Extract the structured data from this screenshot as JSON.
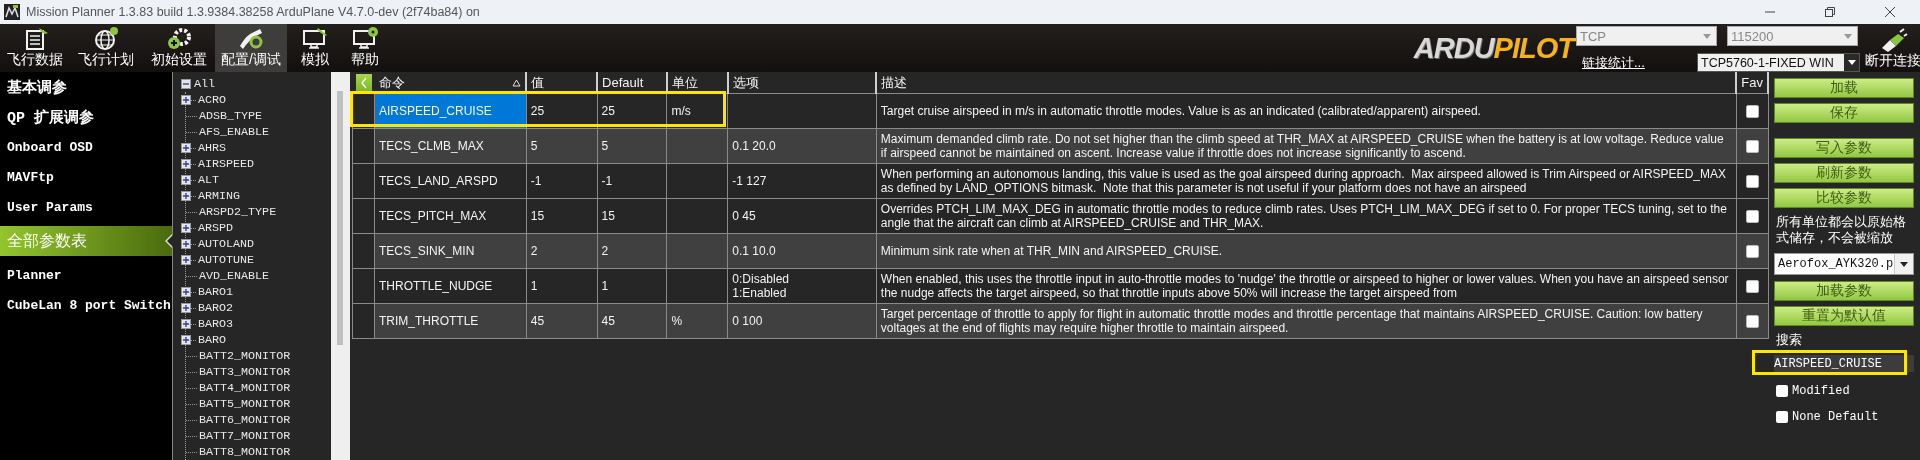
{
  "window": {
    "title": "Mission Planner 1.3.83 build 1.3.9384.38258 ArduPlane V4.7.0-dev (2f74ba84) on"
  },
  "toolbar": {
    "items": [
      {
        "label": "飞行数据",
        "kind": "data",
        "selected": false
      },
      {
        "label": "飞行计划",
        "kind": "plan",
        "selected": false
      },
      {
        "label": "初始设置",
        "kind": "setup",
        "selected": false
      },
      {
        "label": "配置/调试",
        "kind": "config",
        "selected": true
      },
      {
        "label": "模拟",
        "kind": "sim",
        "selected": false
      },
      {
        "label": "帮助",
        "kind": "help",
        "selected": false
      }
    ]
  },
  "logo": {
    "part_1": "ARDU",
    "part_2": "PILOT"
  },
  "connection": {
    "port": "TCP",
    "baud": "115200",
    "stats_link": "链接统计...",
    "profile": "TCP5760-1-FIXED WIN",
    "disconnect": "断开连接"
  },
  "sidebar": {
    "items": [
      {
        "label": "基本调参",
        "selected": false
      },
      {
        "label": "QP 扩展调参",
        "selected": false
      },
      {
        "label": "Onboard OSD",
        "selected": false
      },
      {
        "label": "MAVFtp",
        "selected": false
      },
      {
        "label": "User Params",
        "selected": false
      },
      {
        "label": "全部参数表",
        "selected": true
      },
      {
        "label": "Planner",
        "selected": false
      },
      {
        "label": "CubeLan 8 port Switch",
        "selected": false
      }
    ]
  },
  "tree": {
    "label": "All",
    "expanded": true,
    "children": [
      {
        "label": "ACRO",
        "kind": "group",
        "expanded": false
      },
      {
        "label": "ADSB_TYPE",
        "kind": "leaf"
      },
      {
        "label": "AFS_ENABLE",
        "kind": "leaf"
      },
      {
        "label": "AHRS",
        "kind": "group",
        "expanded": false
      },
      {
        "label": "AIRSPEED",
        "kind": "group",
        "expanded": false
      },
      {
        "label": "ALT",
        "kind": "group",
        "expanded": false
      },
      {
        "label": "ARMING",
        "kind": "group",
        "expanded": false
      },
      {
        "label": "ARSPD2_TYPE",
        "kind": "leaf"
      },
      {
        "label": "ARSPD",
        "kind": "group",
        "expanded": false
      },
      {
        "label": "AUTOLAND",
        "kind": "group",
        "expanded": false
      },
      {
        "label": "AUTOTUNE",
        "kind": "group",
        "expanded": false
      },
      {
        "label": "AVD_ENABLE",
        "kind": "leaf"
      },
      {
        "label": "BARO1",
        "kind": "group",
        "expanded": false
      },
      {
        "label": "BARO2",
        "kind": "group",
        "expanded": false
      },
      {
        "label": "BARO3",
        "kind": "group",
        "expanded": false
      },
      {
        "label": "BARO",
        "kind": "group",
        "expanded": false
      },
      {
        "label": "BATT2_MONITOR",
        "kind": "leaf"
      },
      {
        "label": "BATT3_MONITOR",
        "kind": "leaf"
      },
      {
        "label": "BATT4_MONITOR",
        "kind": "leaf"
      },
      {
        "label": "BATT5_MONITOR",
        "kind": "leaf"
      },
      {
        "label": "BATT6_MONITOR",
        "kind": "leaf"
      },
      {
        "label": "BATT7_MONITOR",
        "kind": "leaf"
      },
      {
        "label": "BATT8_MONITOR",
        "kind": "leaf"
      }
    ]
  },
  "table": {
    "columns": [
      "命令",
      "值",
      "Default",
      "单位",
      "选项",
      "描述",
      "Fav"
    ],
    "rows": [
      {
        "name": "AIRSPEED_CRUISE",
        "value": "25",
        "default": "25",
        "unit": "m/s",
        "description": "Target cruise airspeed in m/s in automatic throttle modes. Value is as an indicated (calibrated/apparent) airspeed.",
        "fav": false,
        "selected": true,
        "shaded": false,
        "highlighted": true
      },
      {
        "name": "TECS_CLMB_MAX",
        "value": "5",
        "default": "5",
        "options": "0.1 20.0",
        "description": "Maximum demanded climb rate. Do not set higher than the climb speed at THR_MAX at AIRSPEED_CRUISE when the battery is at low voltage. Reduce value if airspeed cannot be maintained on ascent. Increase value if throttle does not increase significantly to ascend.",
        "fav": false,
        "selected": false,
        "shaded": true,
        "highlighted": false
      },
      {
        "name": "TECS_LAND_ARSPD",
        "value": "-1",
        "default": "-1",
        "options": "-1 127",
        "description": "When performing an autonomous landing, this value is used as the goal airspeed during approach.  Max airspeed allowed is Trim Airspeed or AIRSPEED_MAX as defined by LAND_OPTIONS bitmask.  Note that this parameter is not useful if your platform does not have an airspeed",
        "fav": false,
        "selected": false,
        "shaded": false,
        "highlighted": false
      },
      {
        "name": "TECS_PITCH_MAX",
        "value": "15",
        "default": "15",
        "options": "0 45",
        "description": "Overrides PTCH_LIM_MAX_DEG in automatic throttle modes to reduce climb rates. Uses PTCH_LIM_MAX_DEG if set to 0. For proper TECS tuning, set to the angle that the aircraft can climb at AIRSPEED_CRUISE and THR_MAX.",
        "fav": false,
        "selected": false,
        "shaded": false,
        "highlighted": false
      },
      {
        "name": "TECS_SINK_MIN",
        "value": "2",
        "default": "2",
        "options": "0.1 10.0",
        "description": "Minimum sink rate when at THR_MIN and AIRSPEED_CRUISE.",
        "fav": false,
        "selected": false,
        "shaded": true,
        "highlighted": false
      },
      {
        "name": "THROTTLE_NUDGE",
        "value": "1",
        "default": "1",
        "options": "0:Disabled\n1:Enabled",
        "description": "When enabled, this uses the throttle input in auto-throttle modes to 'nudge' the throttle or airspeed to higher or lower values. When you have an airspeed sensor the nudge affects the target airspeed, so that throttle inputs above 50% will increase the target airspeed from",
        "fav": false,
        "selected": false,
        "shaded": false,
        "highlighted": false
      },
      {
        "name": "TRIM_THROTTLE",
        "value": "45",
        "default": "45",
        "unit": "%",
        "options": "0 100",
        "description": "Target percentage of throttle to apply for flight in automatic throttle modes and throttle percentage that maintains AIRSPEED_CRUISE. Caution: low battery voltages at the end of flights may require higher throttle to maintain airspeed.",
        "fav": false,
        "selected": false,
        "shaded": true,
        "highlighted": false
      }
    ]
  },
  "actions": {
    "buttons_top": [
      "加载",
      "保存"
    ],
    "buttons_mid": [
      "写入参数",
      "刷新参数",
      "比较参数"
    ],
    "note": "所有单位都会以原始格式储存，不会被缩放",
    "file": "Aerofox_AYK320.p",
    "buttons_bottom": [
      "加载参数",
      "重置为默认值"
    ],
    "search_label": "搜索",
    "search": {
      "value": "AIRSPEED_CRUISE",
      "highlighted": true
    },
    "filters": [
      {
        "label": "Modified",
        "checked": false
      },
      {
        "label": "None Default",
        "checked": false
      }
    ]
  }
}
